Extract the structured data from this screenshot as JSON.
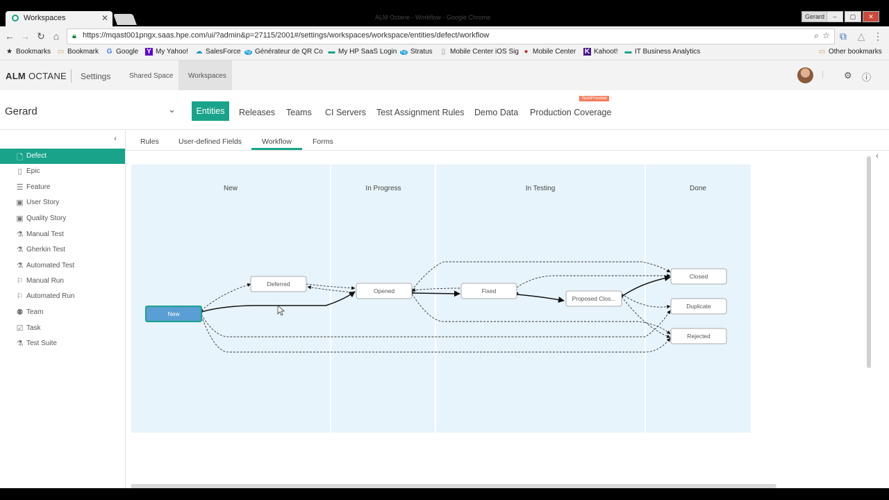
{
  "browser": {
    "tab_title": "Workspaces",
    "faded_title": "ALM Octane - Workflow - Google Chrome",
    "user_badge": "Gerard",
    "url": "https://mqast001pngx.saas.hpe.com/ui/?admin&p=27115/2001#/settings/workspaces/workspace/entities/defect/workflow",
    "bookmarks": [
      {
        "label": "Bookmarks",
        "icon": "star-icon"
      },
      {
        "label": "Bookmark",
        "icon": "folder-icon"
      },
      {
        "label": "Google",
        "icon": "google-icon"
      },
      {
        "label": "My Yahoo!",
        "icon": "yahoo-icon"
      },
      {
        "label": "SalesForce",
        "icon": "cloud-icon"
      },
      {
        "label": "Générateur de QR Co",
        "icon": "hp-icon"
      },
      {
        "label": "My HP SaaS Login",
        "icon": "dash-icon"
      },
      {
        "label": "Stratus",
        "icon": "hp-icon"
      },
      {
        "label": "Mobile Center iOS Sig",
        "icon": "page-icon"
      },
      {
        "label": "Mobile Center",
        "icon": "circle-icon"
      },
      {
        "label": "Kahoot!",
        "icon": "k-icon"
      },
      {
        "label": "IT Business Analytics",
        "icon": "dash-icon"
      }
    ],
    "other_bookmarks": "Other bookmarks"
  },
  "app": {
    "logo_bold": "ALM",
    "logo_rest": "OCTANE",
    "nav": {
      "settings": "Settings",
      "shared_space": "Shared Space",
      "workspaces": "Workspaces"
    }
  },
  "workspace": {
    "name": "Gerard",
    "tabs": {
      "entities": "Entities",
      "releases": "Releases",
      "teams": "Teams",
      "ci_servers": "CI Servers",
      "test_assignment_rules": "Test Assignment Rules",
      "demo_data": "Demo Data",
      "production_coverage": "Production Coverage"
    },
    "tech_preview": "TechPreview"
  },
  "sidebar": {
    "items": [
      {
        "label": "Defect",
        "icon": "defect-icon",
        "active": true
      },
      {
        "label": "Epic",
        "icon": "epic-icon"
      },
      {
        "label": "Feature",
        "icon": "feature-icon"
      },
      {
        "label": "User Story",
        "icon": "user-story-icon"
      },
      {
        "label": "Quality Story",
        "icon": "quality-story-icon"
      },
      {
        "label": "Manual Test",
        "icon": "manual-test-icon"
      },
      {
        "label": "Gherkin Test",
        "icon": "gherkin-test-icon"
      },
      {
        "label": "Automated Test",
        "icon": "automated-test-icon"
      },
      {
        "label": "Manual Run",
        "icon": "manual-run-icon"
      },
      {
        "label": "Automated Run",
        "icon": "automated-run-icon"
      },
      {
        "label": "Team",
        "icon": "team-icon"
      },
      {
        "label": "Task",
        "icon": "task-icon"
      },
      {
        "label": "Test Suite",
        "icon": "test-suite-icon"
      }
    ]
  },
  "subtabs": {
    "rules": "Rules",
    "user_defined_fields": "User-defined Fields",
    "workflow": "Workflow",
    "forms": "Forms"
  },
  "workflow": {
    "phases": [
      "New",
      "In Progress",
      "In Testing",
      "Done"
    ],
    "nodes": {
      "new": "New",
      "deferred": "Deferred",
      "opened": "Opened",
      "fixed": "Fixed",
      "proposed": "Proposed Clos...",
      "closed": "Closed",
      "duplicate": "Duplicate",
      "rejected": "Rejected"
    },
    "colors": {
      "lane_bg": "#e8f4fb",
      "lane_divider": "#ffffff",
      "new_node": "#5a9fd4",
      "new_node_border": "#19a38a",
      "accent": "#19a38a"
    }
  }
}
